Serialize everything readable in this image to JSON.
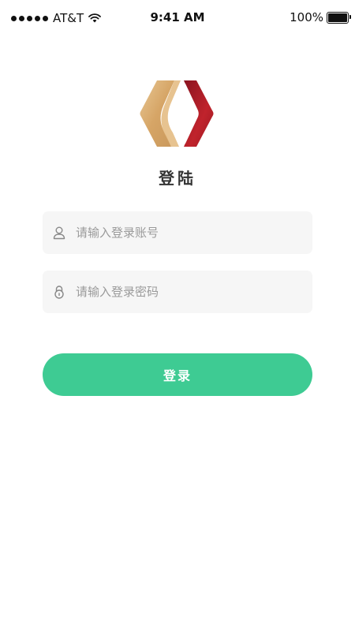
{
  "status_bar": {
    "carrier": "AT&T",
    "time": "9:41 AM",
    "battery_text": "100%",
    "battery_level": 1.0,
    "signal_bars": 5,
    "icons": [
      "signal-dots",
      "wifi-icon",
      "battery-icon"
    ]
  },
  "login": {
    "title": "登陆",
    "account_placeholder": "请输入登录账号",
    "account_value": "",
    "password_placeholder": "请输入登录密码",
    "password_value": "",
    "submit_label": "登录",
    "icons": {
      "account": "user-icon",
      "password": "lock-icon",
      "logo": "brand-logo"
    }
  },
  "colors": {
    "accent": "#3ecb93",
    "field_bg": "#f6f6f6",
    "logo_gold": "#d9ab6d",
    "logo_red": "#b51f2a"
  }
}
